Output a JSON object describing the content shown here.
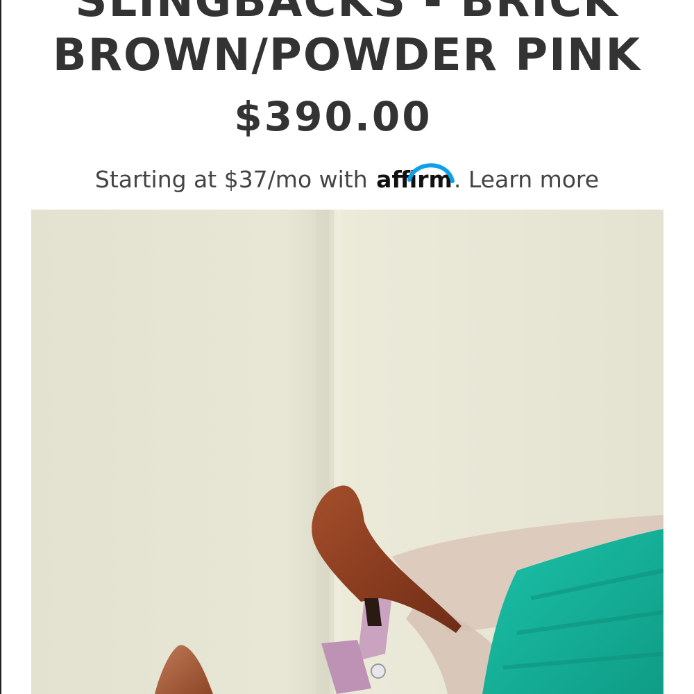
{
  "product": {
    "title_line_1": "SLINGBACKS - BRICK",
    "title_line_2": "BROWN/POWDER PINK",
    "price": "$390.00"
  },
  "financing": {
    "prefix": "Starting at $37/mo with",
    "provider": "affirm",
    "separator": ".",
    "link_label": "Learn more",
    "provider_accent_color": "#0fa0ea"
  },
  "colors": {
    "text": "#333333",
    "wall": "#e6e3d2",
    "shoe_brown": "#8b3f22",
    "heel_pink": "#c9a3c0",
    "skirt_teal": "#17b29c"
  }
}
